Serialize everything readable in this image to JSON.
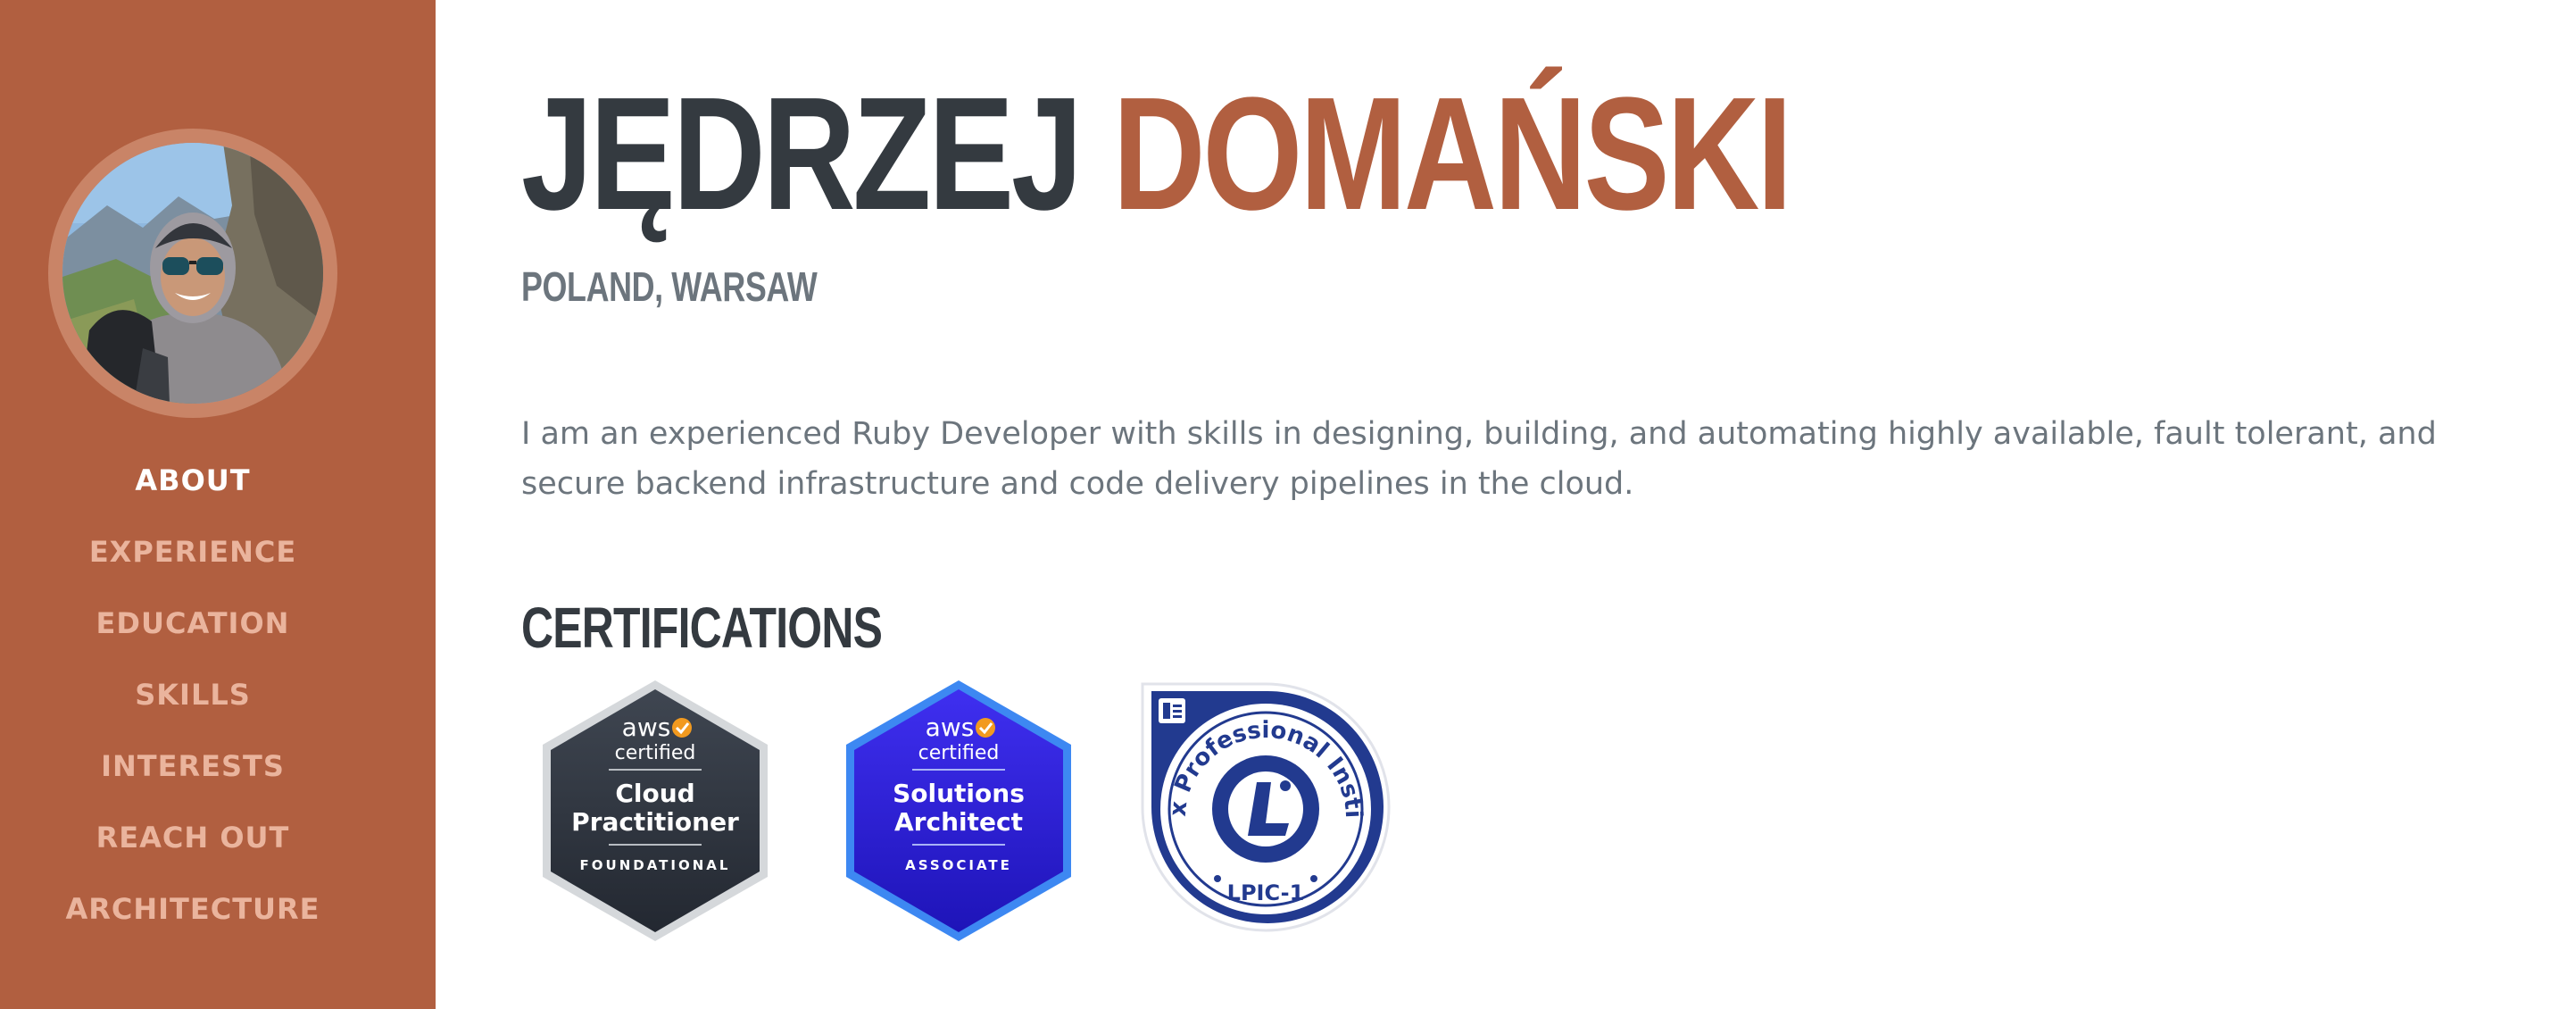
{
  "profile": {
    "first_name": "JĘDRZEJ",
    "last_name": "DOMAŃSKI",
    "location": "POLAND, WARSAW",
    "intro": "I am an experienced Ruby Developer with skills in designing, building, and automating highly available, fault tolerant, and secure backend infrastructure and code delivery pipelines in the cloud."
  },
  "sidebar": {
    "items": [
      {
        "label": "ABOUT"
      },
      {
        "label": "EXPERIENCE"
      },
      {
        "label": "EDUCATION"
      },
      {
        "label": "SKILLS"
      },
      {
        "label": "INTERESTS"
      },
      {
        "label": "REACH OUT"
      },
      {
        "label": "ARCHITECTURE"
      }
    ]
  },
  "certifications": {
    "title": "CERTIFICATIONS",
    "badges": [
      {
        "brand": "aws",
        "line1": "certified",
        "name1": "Cloud",
        "name2": "Practitioner",
        "level": "FOUNDATIONAL"
      },
      {
        "brand": "aws",
        "line1": "certified",
        "name1": "Solutions",
        "name2": "Architect",
        "level": "ASSOCIATE"
      },
      {
        "ring_text": "Linux Professional Institute",
        "level": "LPIC-1"
      }
    ]
  },
  "colors": {
    "accent": "#b15f40",
    "dark": "#343a40",
    "muted": "#6c757d",
    "nav_inactive": "#eab49d"
  }
}
